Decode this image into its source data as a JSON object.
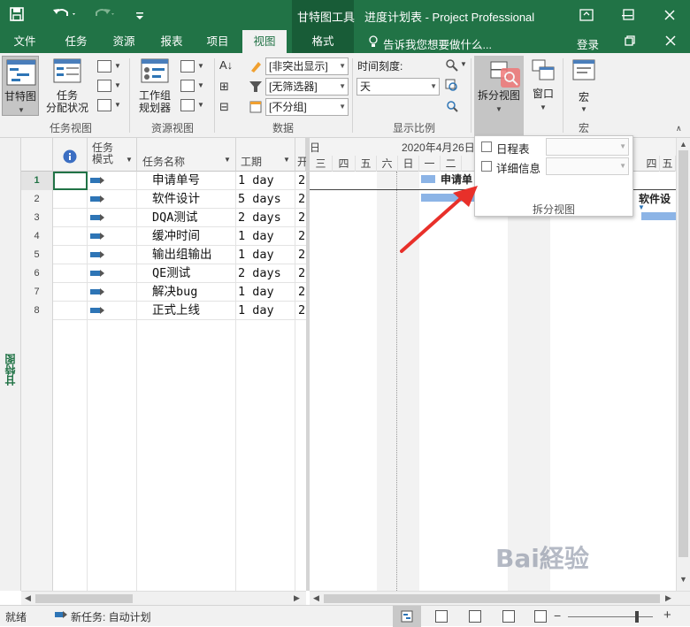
{
  "titlebar": {
    "context_tool": "甘特图工具",
    "title": "进度计划表 - Project Professional",
    "save_icon": "save-icon",
    "undo_icon": "undo-icon",
    "redo_icon": "redo-icon"
  },
  "tabs": [
    {
      "label": "文件"
    },
    {
      "label": "任务"
    },
    {
      "label": "资源"
    },
    {
      "label": "报表"
    },
    {
      "label": "项目"
    },
    {
      "label": "视图"
    },
    {
      "label": "格式"
    }
  ],
  "tellme": "告诉我您想要做什么...",
  "login": "登录",
  "ribbon": {
    "gantt_btn": "甘特图",
    "task_usage_l1": "任务",
    "task_usage_l2": "分配状况",
    "team_planner_l1": "工作组",
    "team_planner_l2": "规划器",
    "group_task_views": "任务视图",
    "group_resource_views": "资源视图",
    "highlight_combo": "[非突出显示]",
    "filter_combo": "[无筛选器]",
    "group_combo": "[不分组]",
    "group_data": "数据",
    "timescale_label": "时间刻度:",
    "timescale_value": "天",
    "group_zoom": "显示比例",
    "split_view": "拆分视图",
    "window": "窗口",
    "macro": "宏",
    "group_macro": "宏"
  },
  "popup": {
    "timeline_label": "日程表",
    "details_label": "详细信息",
    "group_label": "拆分视图"
  },
  "grid": {
    "header_mode_l1": "任务",
    "header_mode_l2": "模式",
    "header_name": "任务名称",
    "header_duration": "工期",
    "header_start": "开",
    "rows": [
      {
        "num": "1",
        "name": "申请单号",
        "duration": "1 day",
        "start": "2"
      },
      {
        "num": "2",
        "name": "软件设计",
        "duration": "5 days",
        "start": "2"
      },
      {
        "num": "3",
        "name": "DQA测试",
        "duration": "2 days",
        "start": "2"
      },
      {
        "num": "4",
        "name": "缓冲时间",
        "duration": "1 day",
        "start": "2"
      },
      {
        "num": "5",
        "name": "输出组输出",
        "duration": "1 day",
        "start": "2"
      },
      {
        "num": "6",
        "name": "QE测试",
        "duration": "2 days",
        "start": "2"
      },
      {
        "num": "7",
        "name": "解决bug",
        "duration": "1 day",
        "start": "2"
      },
      {
        "num": "8",
        "name": "正式上线",
        "duration": "1 day",
        "start": "2"
      }
    ]
  },
  "gantt": {
    "top_left": "日",
    "week_label": "2020年4月26日",
    "days": [
      "三",
      "四",
      "五",
      "六",
      "日",
      "一",
      "二"
    ],
    "days_right": [
      "四",
      "五"
    ],
    "bar_label_1": "申请单",
    "bar_label_2": "软件设"
  },
  "viewbar_label": "甘特图",
  "status": {
    "ready": "就绪",
    "new_task": "新任务: 自动计划"
  },
  "watermark": "Bai経验",
  "colors": {
    "brand": "#217346",
    "context": "#185c37",
    "bar": "#8cb4e6",
    "arrow": "#e8302a"
  }
}
